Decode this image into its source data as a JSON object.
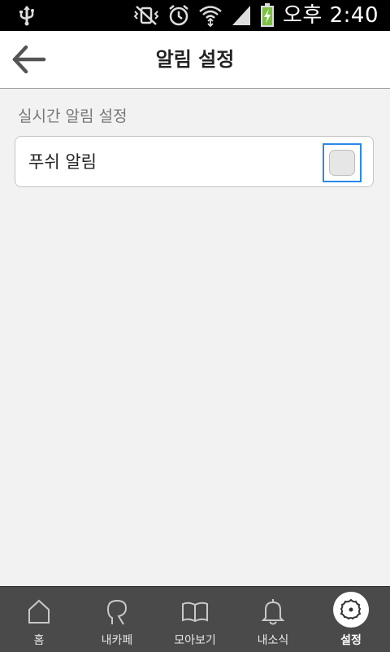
{
  "status_bar": {
    "time": "오후 2:40",
    "icons": [
      "usb-icon",
      "vibrate-icon",
      "alarm-icon",
      "wifi-icon",
      "signal-icon",
      "battery-charging-icon"
    ]
  },
  "header": {
    "title": "알림 설정",
    "back_icon": "arrow-left-icon"
  },
  "section": {
    "label": "실시간 알림 설정"
  },
  "settings": {
    "push_label": "푸쉬 알림",
    "push_checked": false
  },
  "bottom_nav": {
    "items": [
      {
        "label": "홈",
        "icon": "home-icon"
      },
      {
        "label": "내카페",
        "icon": "my-cafe-icon"
      },
      {
        "label": "모아보기",
        "icon": "book-icon"
      },
      {
        "label": "내소식",
        "icon": "bell-icon"
      },
      {
        "label": "설정",
        "icon": "gear-icon",
        "active": true
      }
    ]
  },
  "colors": {
    "accent": "#2a8ae8",
    "nav_bg": "#4a4a4a",
    "status_bg": "#000000",
    "battery_green": "#7bc341"
  }
}
